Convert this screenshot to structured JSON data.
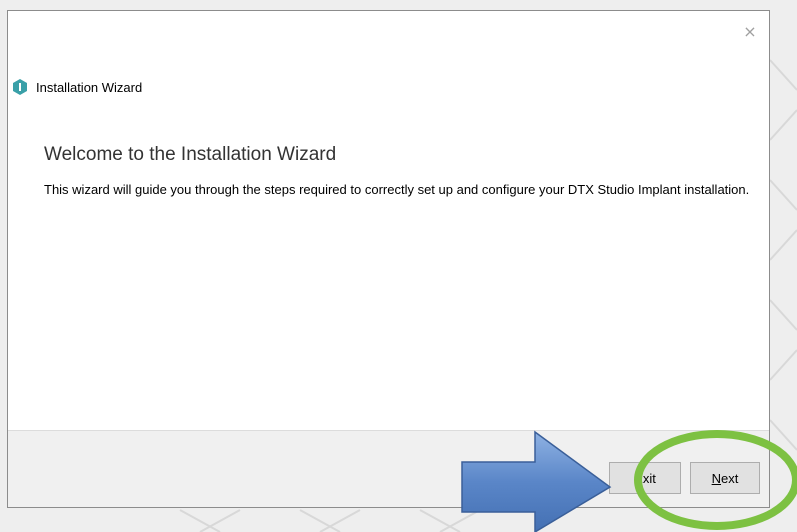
{
  "window": {
    "title": "Installation Wizard",
    "close_glyph": "×"
  },
  "content": {
    "heading": "Welcome to the Installation Wizard",
    "description": "This wizard will guide you through the steps required to correctly set up and configure your DTX Studio Implant installation."
  },
  "footer": {
    "exit_label": "Exit",
    "next_mnemonic": "N",
    "next_rest": "ext"
  },
  "annotations": {
    "arrow_icon": "right-arrow-icon",
    "highlight_icon": "green-circle-highlight",
    "arrow_color": "#5a86c8",
    "circle_color": "#7dc142"
  },
  "colors": {
    "app_icon": "#3aa0a8",
    "footer_bg": "#f0f0f0"
  }
}
